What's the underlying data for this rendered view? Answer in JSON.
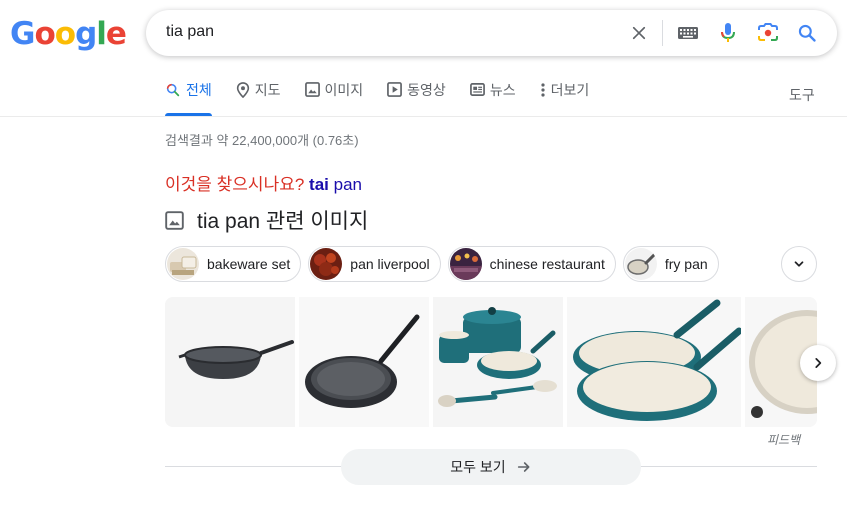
{
  "logo": {
    "letters": [
      "G",
      "o",
      "o",
      "g",
      "l",
      "e"
    ],
    "colors": [
      "#4285f4",
      "#ea4335",
      "#fbbc05",
      "#4285f4",
      "#34a853",
      "#ea4335"
    ]
  },
  "search": {
    "query": "tia pan"
  },
  "tabs": [
    {
      "label": "전체",
      "icon": "search-icon",
      "active": true
    },
    {
      "label": "지도",
      "icon": "map-pin-icon"
    },
    {
      "label": "이미지",
      "icon": "image-icon"
    },
    {
      "label": "동영상",
      "icon": "video-icon"
    },
    {
      "label": "뉴스",
      "icon": "news-icon"
    },
    {
      "label": "더보기",
      "icon": "more-dots-icon"
    }
  ],
  "tools_label": "도구",
  "result_stats": "검색결과 약 22,400,000개 (0.76초)",
  "did_you_mean": {
    "label": "이것을 찾으시나요?",
    "bold": "tai",
    "rest": " pan"
  },
  "images_heading": "tia pan 관련 이미지",
  "chips": [
    {
      "label": "bakeware set"
    },
    {
      "label": "pan liverpool"
    },
    {
      "label": "chinese restaurant"
    },
    {
      "label": "fry pan"
    }
  ],
  "feedback_label": "피드백",
  "see_all_label": "모두 보기",
  "colors": {
    "accent": "#1a73e8",
    "link": "#1a0dab",
    "dym_red": "#d93025",
    "teal": "#1f6f7a"
  }
}
